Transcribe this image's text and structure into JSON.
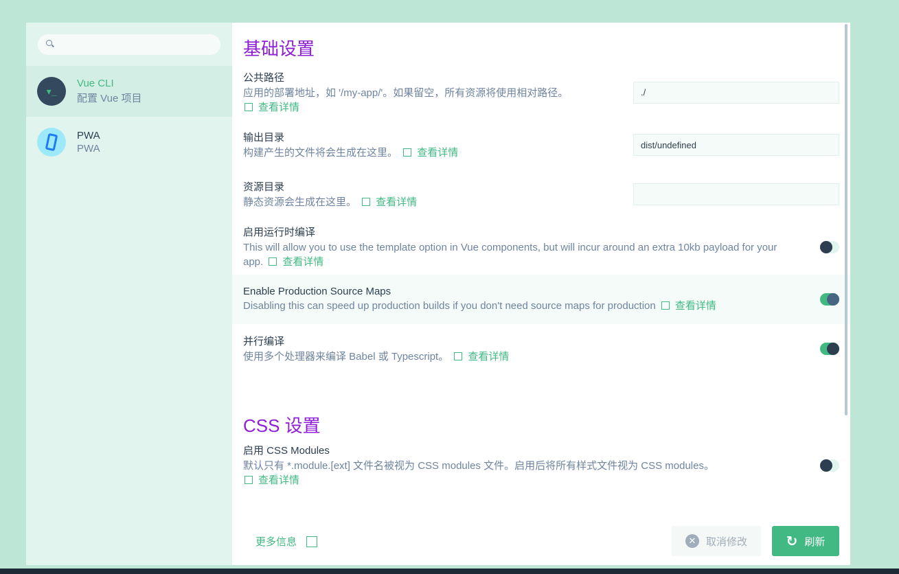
{
  "sidebar": {
    "search_placeholder": "",
    "items": [
      {
        "title": "Vue CLI",
        "subtitle": "配置 Vue 项目"
      },
      {
        "title": "PWA",
        "subtitle": "PWA"
      }
    ]
  },
  "sections": [
    {
      "title": "基础设置"
    },
    {
      "title": "CSS 设置"
    }
  ],
  "more_link": "查看详情",
  "settings": [
    {
      "label": "公共路径",
      "desc": "应用的部署地址，如 '/my-app/'。如果留空，所有资源将使用相对路径。",
      "value": "./"
    },
    {
      "label": "输出目录",
      "desc": "构建产生的文件将会生成在这里。",
      "value": "dist/undefined"
    },
    {
      "label": "资源目录",
      "desc": "静态资源会生成在这里。",
      "value": ""
    },
    {
      "label": "启用运行时编译",
      "desc": "This will allow you to use the template option in Vue components, but will incur around an extra 10kb payload for your app.",
      "enabled": false
    },
    {
      "label": "Enable Production Source Maps",
      "desc": "Disabling this can speed up production builds if you don't need source maps for production",
      "enabled": true
    },
    {
      "label": "并行编译",
      "desc": "使用多个处理器来编译 Babel 或 Typescript。",
      "enabled": true
    },
    {
      "label": "启用 CSS Modules",
      "desc": "默认只有 *.module.[ext] 文件名被视为 CSS modules 文件。启用后将所有样式文件视为 CSS modules。",
      "enabled": false
    }
  ],
  "footer": {
    "more_info": "更多信息",
    "cancel": "取消修改",
    "refresh": "刷新"
  }
}
